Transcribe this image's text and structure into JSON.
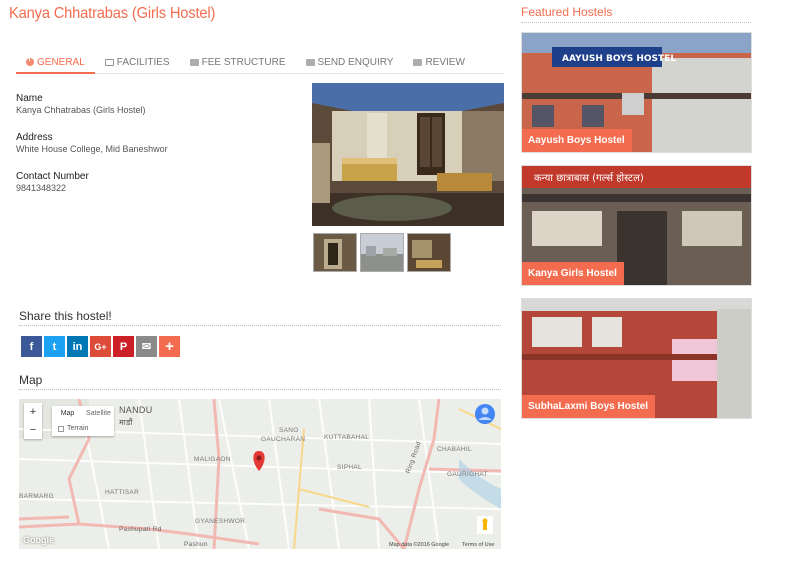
{
  "page": {
    "title": "Kanya Chhatrabas (Girls Hostel)"
  },
  "tabs": [
    {
      "label": "GENERAL",
      "icon": "info-icon",
      "active": true
    },
    {
      "label": "FACILITIES",
      "icon": "money-icon"
    },
    {
      "label": "FEE STRUCTURE",
      "icon": "envelope-icon"
    },
    {
      "label": "SEND ENQUIRY",
      "icon": "envelope-icon"
    },
    {
      "label": "REVIEW",
      "icon": "envelope-icon"
    }
  ],
  "details": {
    "name_label": "Name",
    "name_value": "Kanya Chhatrabas (Girls Hostel)",
    "address_label": "Address",
    "address_value": "White House College, Mid Baneshwor",
    "contact_label": "Contact Number",
    "contact_value": "9841348322"
  },
  "share": {
    "heading": "Share this hostel!",
    "buttons": [
      {
        "name": "facebook",
        "glyph": "f",
        "color": "#3b5998"
      },
      {
        "name": "twitter",
        "glyph": "t",
        "color": "#1da1f2"
      },
      {
        "name": "linkedin",
        "glyph": "in",
        "color": "#0077b5"
      },
      {
        "name": "google-plus",
        "glyph": "G+",
        "color": "#dd4b39"
      },
      {
        "name": "pinterest",
        "glyph": "P",
        "color": "#cb2027"
      },
      {
        "name": "email",
        "glyph": "✉",
        "color": "#8a8a8a"
      },
      {
        "name": "more",
        "glyph": "+",
        "color": "#f36c4f"
      }
    ]
  },
  "map": {
    "heading": "Map",
    "zoom_in": "+",
    "zoom_out": "−",
    "type_map": "Map",
    "type_satellite": "Satellite",
    "terrain": "Terrain",
    "labels": {
      "kathmandu": "NANDU",
      "kathmandu_dev": "माडौं",
      "sano_gaucharan": "SANO",
      "sano_gaucharan2": "GAUCHARAN",
      "kuttabahal": "KUTTABAHAL",
      "chabahil": "CHABAHIL",
      "maligaon": "MALIGAON",
      "siphal": "SIPHAL",
      "gaurighat": "GAURIGHAT",
      "hattisar": "HATTISAR",
      "barmarg": "BARMARG",
      "gyaneshwor": "GYANESHWOR",
      "pashupati_rd": "Pashupati Rd",
      "pashupati_rd2": "Pashun",
      "ring_road": "Ring Road"
    },
    "footer_data": "Map data ©2016 Google",
    "footer_terms": "Terms of Use",
    "logo": "Google"
  },
  "sidebar": {
    "title": "Featured Hostels",
    "items": [
      {
        "label": "Aayush Boys Hostel",
        "sign": "AAYUSH BOYS HOSTEL"
      },
      {
        "label": "Kanya Girls Hostel",
        "sign": "कन्या छात्राबास (गर्ल्स हाेस्टल)"
      },
      {
        "label": "SubhaLaxmi Boys Hostel"
      }
    ]
  },
  "colors": {
    "accent": "#f36c4f"
  }
}
